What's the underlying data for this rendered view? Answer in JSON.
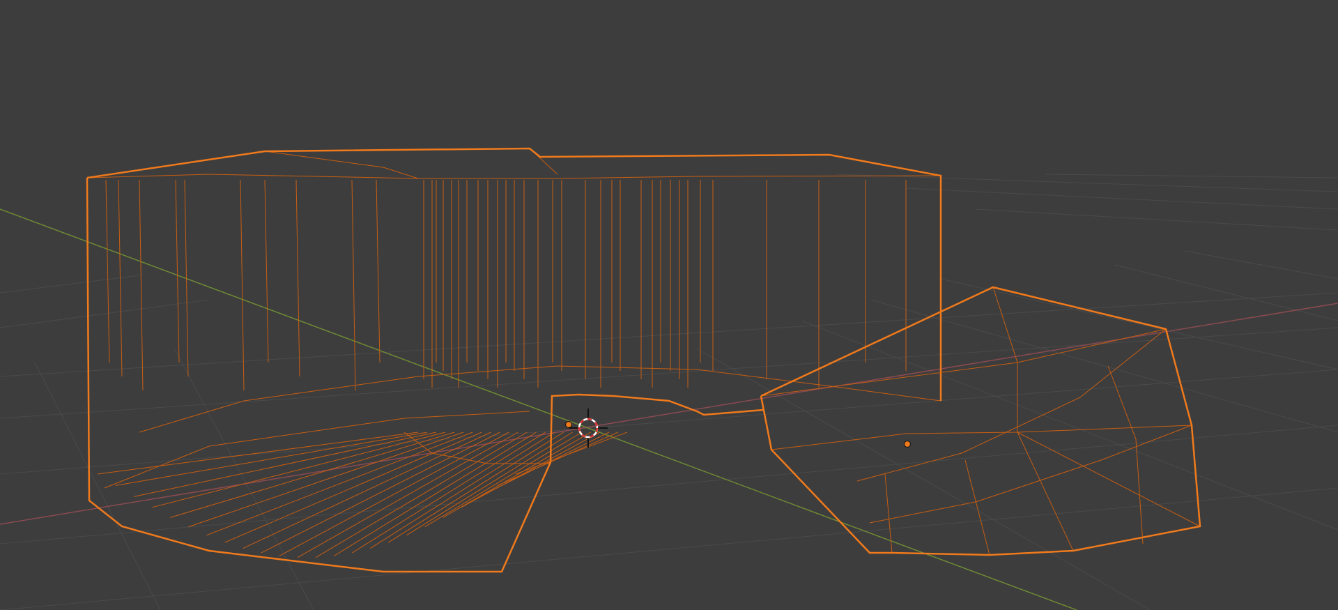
{
  "viewport": {
    "background": "#3d3d3d",
    "grid_color": "#4a4a4a",
    "x_axis_color": "#8a4a50",
    "y_axis_color": "#6e8a34",
    "selection_color": "#f07a1c",
    "selection_dim_color": "#c85e12",
    "cursor_icon": "3d-cursor-icon",
    "origin_icon": "object-origin-icon"
  }
}
